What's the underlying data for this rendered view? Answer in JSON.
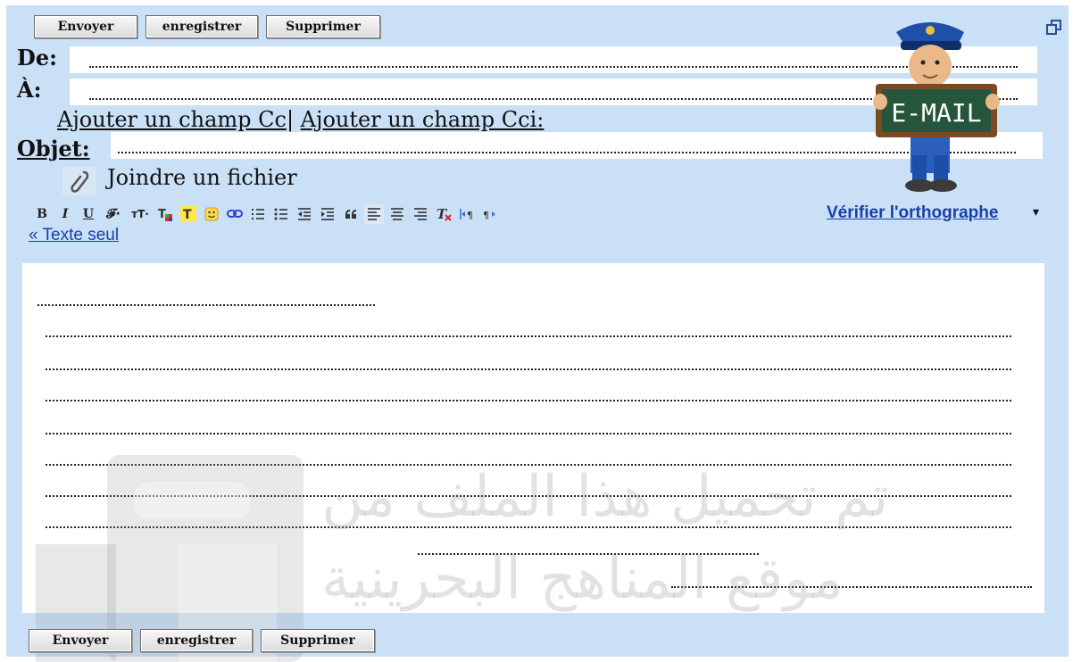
{
  "toolbar_top": {
    "send": "Envoyer",
    "save": "enregistrer",
    "delete": "Supprimer"
  },
  "toolbar_bottom": {
    "send": "Envoyer",
    "save": "enregistrer",
    "delete": "Supprimer"
  },
  "fields": {
    "from_label": "De:",
    "to_label": "À:",
    "subject_label": "Objet:"
  },
  "links": {
    "add_cc": "Ajouter un champ Cc",
    "sep": "|",
    "add_bcc": "Ajouter un champ Cci:",
    "attach": "Joindre un fichier"
  },
  "format_bar": {
    "bold": "B",
    "italic": "I",
    "underline": "U",
    "font": "𝓕·",
    "size": "тT·",
    "spellcheck": "Vérifier l'orthographe",
    "spell_arrow": "▾",
    "plain_text": "« Texte seul"
  },
  "clipart": {
    "sign_text": "E-MAIL"
  },
  "watermark": {
    "line1": "تم تحميل هذا الملف من",
    "line2": "موقع المناهج البحرينية"
  },
  "colors": {
    "frame": "#c9e0f7",
    "link_blue": "#1a3fa8"
  }
}
